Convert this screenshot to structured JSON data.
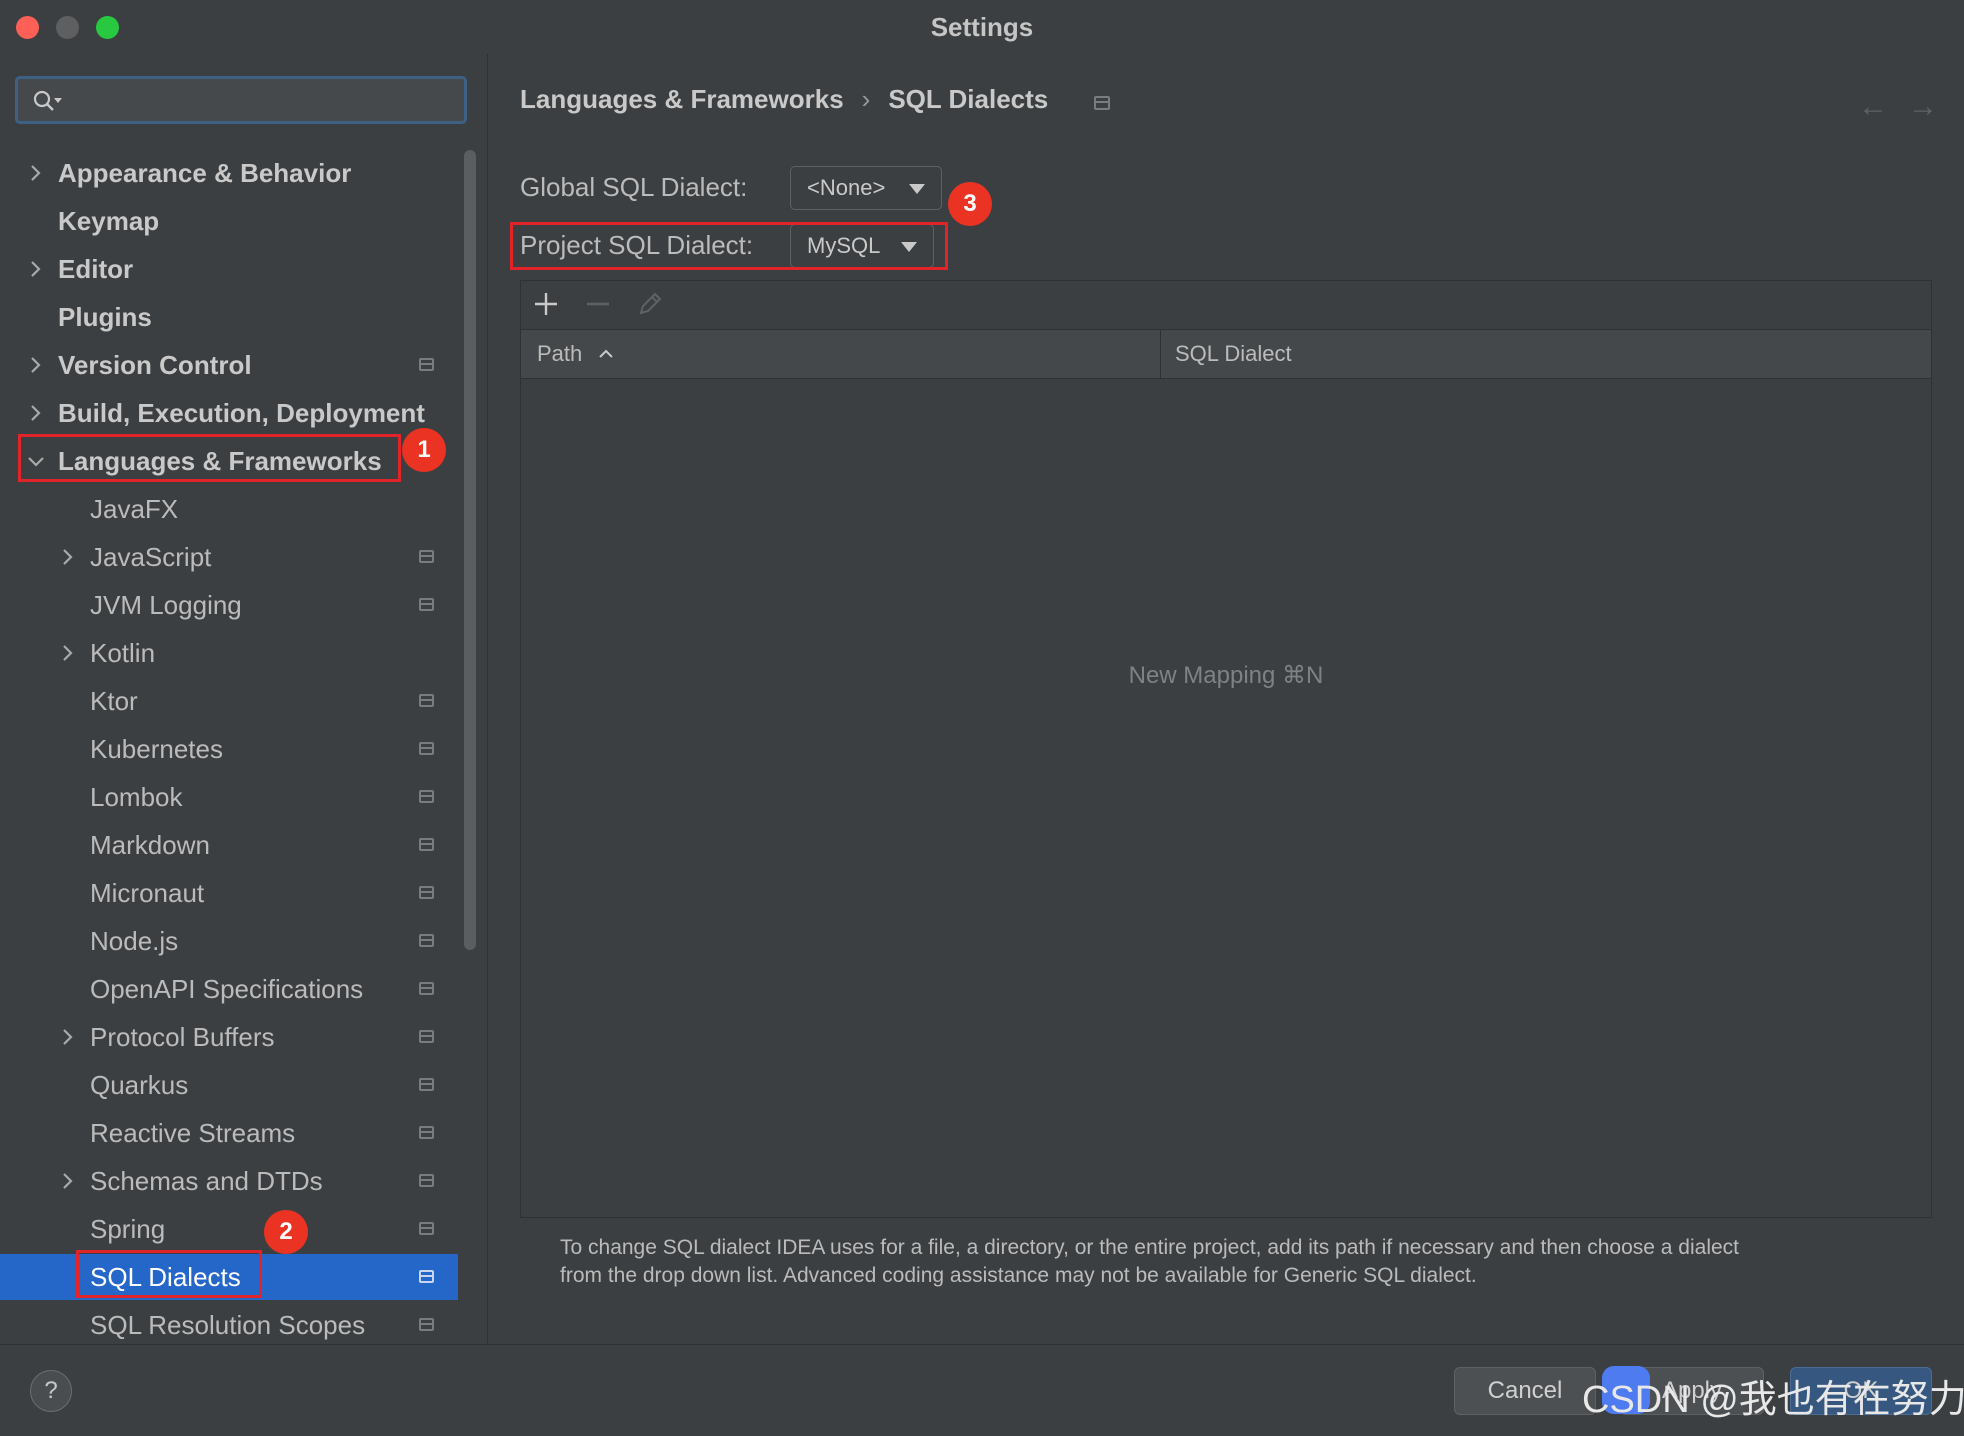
{
  "window": {
    "title": "Settings"
  },
  "search": {
    "placeholder": ""
  },
  "sidebar": {
    "items": [
      {
        "label": "Appearance & Behavior"
      },
      {
        "label": "Keymap"
      },
      {
        "label": "Editor"
      },
      {
        "label": "Plugins"
      },
      {
        "label": "Version Control"
      },
      {
        "label": "Build, Execution, Deployment"
      },
      {
        "label": "Languages & Frameworks"
      },
      {
        "label": "JavaFX"
      },
      {
        "label": "JavaScript"
      },
      {
        "label": "JVM Logging"
      },
      {
        "label": "Kotlin"
      },
      {
        "label": "Ktor"
      },
      {
        "label": "Kubernetes"
      },
      {
        "label": "Lombok"
      },
      {
        "label": "Markdown"
      },
      {
        "label": "Micronaut"
      },
      {
        "label": "Node.js"
      },
      {
        "label": "OpenAPI Specifications"
      },
      {
        "label": "Protocol Buffers"
      },
      {
        "label": "Quarkus"
      },
      {
        "label": "Reactive Streams"
      },
      {
        "label": "Schemas and DTDs"
      },
      {
        "label": "Spring"
      },
      {
        "label": "SQL Dialects"
      },
      {
        "label": "SQL Resolution Scopes"
      }
    ]
  },
  "breadcrumb": {
    "parent": "Languages & Frameworks",
    "separator": "›",
    "current": "SQL Dialects"
  },
  "nav": {
    "back": "←",
    "forward": "→"
  },
  "form": {
    "global_label": "Global SQL Dialect:",
    "global_value": "<None>",
    "project_label": "Project SQL Dialect:",
    "project_value": "MySQL"
  },
  "table": {
    "columns": [
      "Path",
      "SQL Dialect"
    ],
    "empty_text": "New Mapping ⌘N"
  },
  "hint": {
    "line1": "To change SQL dialect IDEA uses for a file, a directory, or the entire project, add its path if necessary and then choose a dialect",
    "line2": "from the drop down list. Advanced coding assistance may not be available for Generic SQL dialect."
  },
  "footer": {
    "help": "?",
    "cancel": "Cancel",
    "apply": "Apply",
    "ok": "OK"
  },
  "annotations": {
    "badge1": "1",
    "badge2": "2",
    "badge3": "3"
  },
  "watermark": "CSDN @我也有在努力",
  "colors": {
    "accent_selection": "#2566c9",
    "annotation_red": "#e0242a",
    "badge_red": "#ea3323"
  }
}
